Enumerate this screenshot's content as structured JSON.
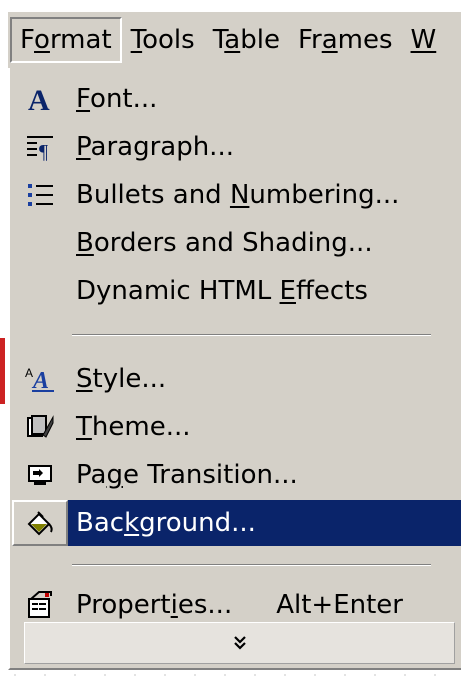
{
  "menubar": {
    "items": [
      {
        "label": "Format",
        "accel_index": 1,
        "open": true
      },
      {
        "label": "Tools",
        "accel_index": 0
      },
      {
        "label": "Table",
        "accel_index": 1
      },
      {
        "label": "Frames",
        "accel_index": 2
      },
      {
        "label": "W",
        "accel_index": 0
      }
    ]
  },
  "menu": {
    "groups": [
      [
        {
          "label": "Font...",
          "accel": "F",
          "icon": "font-icon"
        },
        {
          "label": "Paragraph...",
          "accel": "P",
          "icon": "paragraph-icon"
        },
        {
          "label": "Bullets and Numbering...",
          "accel": "N",
          "icon": "bullets-icon"
        },
        {
          "label": "Borders and Shading...",
          "accel": "B",
          "icon": ""
        },
        {
          "label": "Dynamic HTML Effects",
          "accel": "E",
          "icon": ""
        }
      ],
      [
        {
          "label": "Style...",
          "accel": "S",
          "icon": "style-icon"
        },
        {
          "label": "Theme...",
          "accel": "T",
          "icon": "theme-icon"
        },
        {
          "label": "Page Transition...",
          "accel": "g",
          "icon": "page-transition-icon"
        },
        {
          "label": "Background...",
          "accel": "k",
          "icon": "background-icon",
          "highlighted": true
        }
      ],
      [
        {
          "label": "Properties...",
          "accel": "i",
          "icon": "properties-icon",
          "shortcut": "Alt+Enter"
        }
      ]
    ],
    "expand_icon": "double-chevron-down-icon"
  },
  "colors": {
    "menu_bg": "#d4d0c8",
    "highlight_bg": "#0a246a",
    "highlight_text": "#ffffff"
  }
}
